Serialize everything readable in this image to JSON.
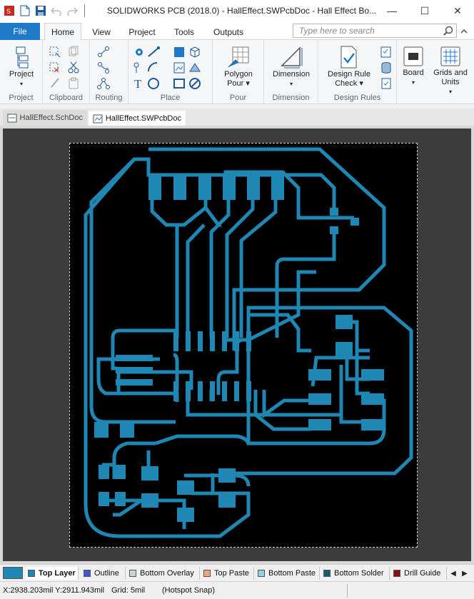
{
  "app": {
    "title": "SOLIDWORKS PCB (2018.0) - HallEffect.SWPcbDoc - Hall Effect Bo...",
    "window_buttons": {
      "minimize": "—",
      "maximize": "☐",
      "close": "✕"
    }
  },
  "ribbon_tabs": {
    "file": "File",
    "tabs": [
      "Home",
      "View",
      "Project",
      "Tools",
      "Outputs"
    ],
    "active": "Home",
    "search_placeholder": "Type here to search"
  },
  "ribbon": {
    "project": {
      "button": "Project",
      "group": "Project"
    },
    "clipboard": {
      "group": "Clipboard"
    },
    "routing": {
      "group": "Routing"
    },
    "place": {
      "group": "Place"
    },
    "pour": {
      "button_line1": "Polygon",
      "button_line2": "Pour",
      "group": "Pour"
    },
    "dimension": {
      "button": "Dimension",
      "group": "Dimension"
    },
    "design_rules": {
      "button_line1": "Design Rule",
      "button_line2": "Check",
      "group": "Design Rules"
    },
    "board": {
      "button": "Board"
    },
    "grids": {
      "button_line1": "Grids and",
      "button_line2": "Units"
    }
  },
  "doc_tabs": [
    {
      "label": "HallEffect.SchDoc",
      "active": false
    },
    {
      "label": "HallEffect.SWPcbDoc",
      "active": true
    }
  ],
  "colors": {
    "trace": "#1f87b4",
    "board_bg": "#000000",
    "canvas_bg": "#3c3c3c",
    "accent": "#1e7ac9"
  },
  "layers": [
    {
      "label": "Top Layer",
      "color": "#1f87b4",
      "active": true
    },
    {
      "label": "Outline",
      "color": "#3a5ad8",
      "active": false
    },
    {
      "label": "Bottom Overlay",
      "color": "#c8d6d0",
      "active": false
    },
    {
      "label": "Top Paste",
      "color": "#f2a77a",
      "active": false
    },
    {
      "label": "Bottom Paste",
      "color": "#8fd0e6",
      "active": false
    },
    {
      "label": "Bottom Solder",
      "color": "#1a5a70",
      "active": false
    },
    {
      "label": "Drill Guide",
      "color": "#8b1010",
      "active": false
    }
  ],
  "status": {
    "coords": "X:2938.203mil Y:2911.943mil",
    "grid": "Grid: 5mil",
    "snap": "(Hotspot Snap)"
  }
}
